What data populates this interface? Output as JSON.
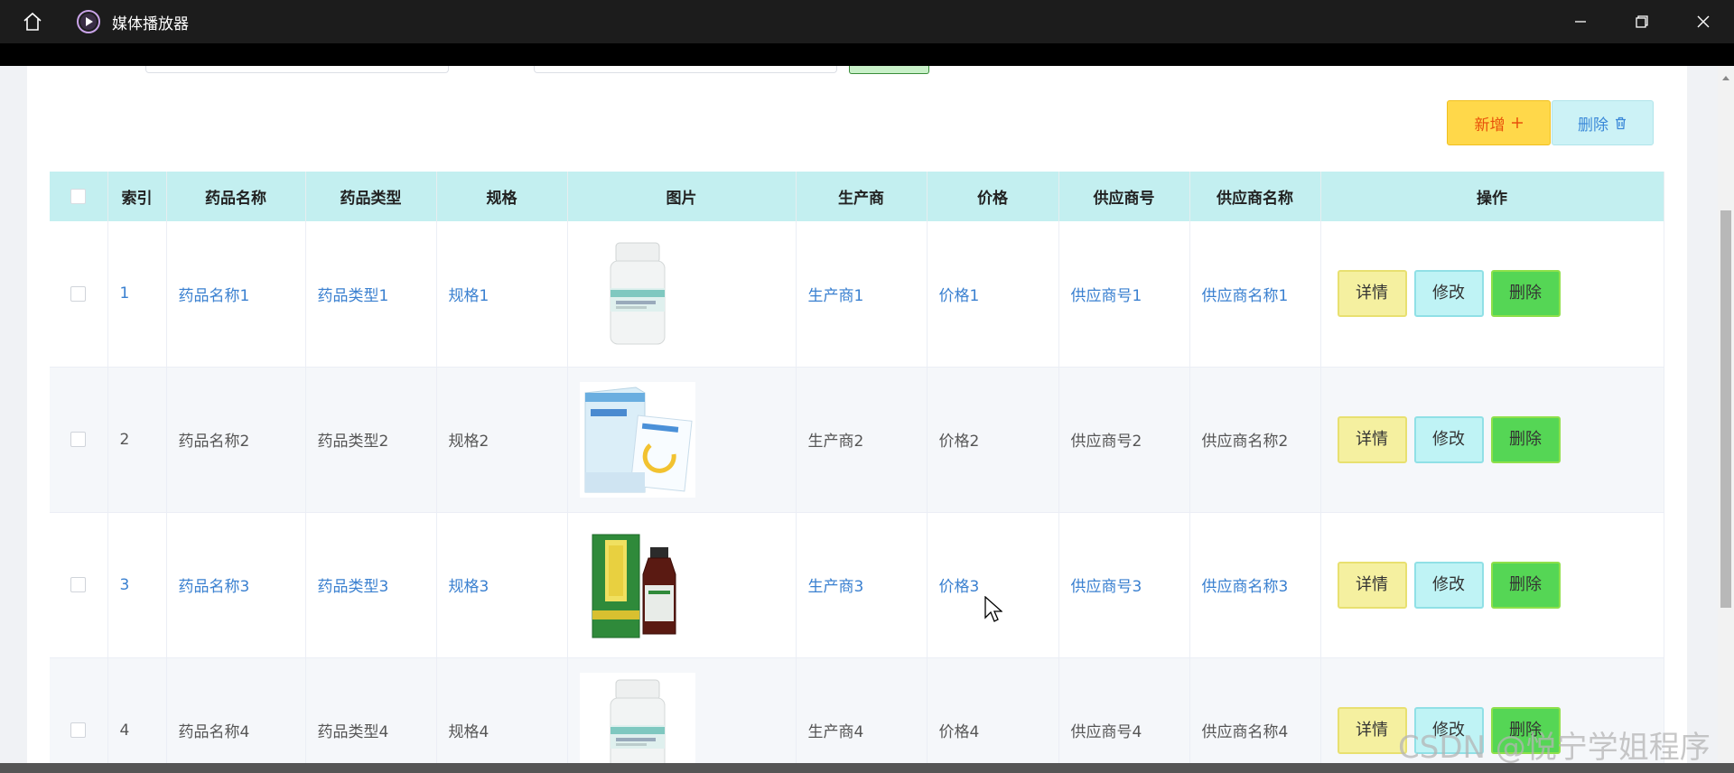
{
  "window": {
    "title": "媒体播放器",
    "home_icon": "home-icon",
    "app_icon": "play-circle-icon",
    "controls": [
      "minimize-icon",
      "restore-icon",
      "close-icon"
    ]
  },
  "toolbar": {
    "add_label": "新增",
    "add_icon": "plus-icon",
    "delete_label": "删除",
    "delete_icon": "trash-icon"
  },
  "table": {
    "headers": {
      "index": "索引",
      "name": "药品名称",
      "type": "药品类型",
      "spec": "规格",
      "image": "图片",
      "maker": "生产商",
      "price": "价格",
      "supplier_no": "供应商号",
      "supplier_name": "供应商名称",
      "actions": "操作"
    },
    "rows": [
      {
        "index": "1",
        "name": "药品名称1",
        "type": "药品类型1",
        "spec": "规格1",
        "maker": "生产商1",
        "price": "价格1",
        "supplier_no": "供应商号1",
        "supplier_name": "供应商名称1",
        "image": "medicine-bottle-white"
      },
      {
        "index": "2",
        "name": "药品名称2",
        "type": "药品类型2",
        "spec": "规格2",
        "maker": "生产商2",
        "price": "价格2",
        "supplier_no": "供应商号2",
        "supplier_name": "供应商名称2",
        "image": "medicine-box-sachet"
      },
      {
        "index": "3",
        "name": "药品名称3",
        "type": "药品类型3",
        "spec": "规格3",
        "maker": "生产商3",
        "price": "价格3",
        "supplier_no": "供应商号3",
        "supplier_name": "供应商名称3",
        "image": "syrup-box-bottle"
      },
      {
        "index": "4",
        "name": "药品名称4",
        "type": "药品类型4",
        "spec": "规格4",
        "maker": "生产商4",
        "price": "价格4",
        "supplier_no": "供应商号4",
        "supplier_name": "供应商名称4",
        "image": "medicine-bottle-white"
      }
    ],
    "actions": {
      "detail": "详情",
      "edit": "修改",
      "delete": "删除"
    }
  },
  "watermark": "CSDN @悦宁学姐程序",
  "colors": {
    "header_bg": "#c3eff0",
    "link": "#3a80d0",
    "add_bg": "#ffd84a",
    "delete_bg": "#ccf2f6",
    "detail_bg": "#f5f0a0",
    "edit_bg": "#bff3f5",
    "delete_row_bg": "#55d655"
  }
}
